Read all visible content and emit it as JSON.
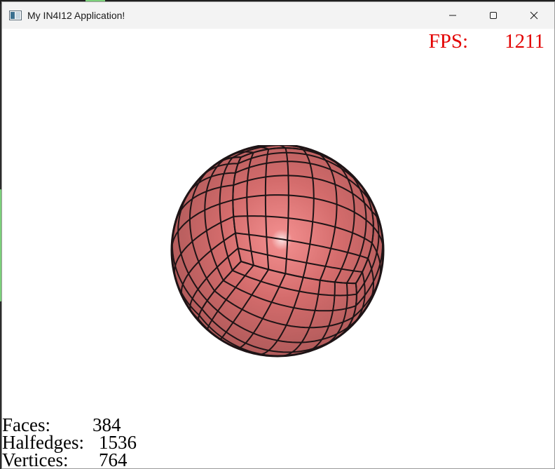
{
  "window": {
    "title": "My IN4I12 Application!"
  },
  "overlay": {
    "fps_label": "FPS:",
    "fps_value": "1211"
  },
  "stats": [
    {
      "label": "Faces:",
      "value": "384"
    },
    {
      "label": "Halfedges:",
      "value": "1536"
    },
    {
      "label": "Vertices:",
      "value": "764"
    }
  ],
  "colors": {
    "fps_text": "#e30000",
    "sphere_base": "#d96a6a",
    "wire": "#1e1416"
  },
  "icons": [
    "app-icon",
    "minimize-icon",
    "maximize-icon",
    "close-icon"
  ]
}
